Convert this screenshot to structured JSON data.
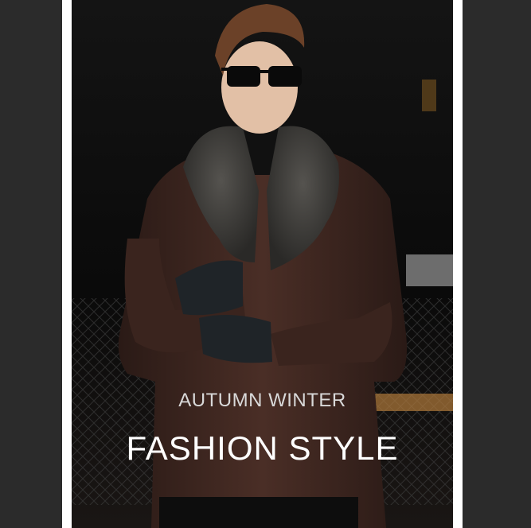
{
  "banner": {
    "subtitle": "AUTUMN WINTER",
    "title": "FASHION STYLE"
  },
  "colors": {
    "outer_background": "#2b2b2b",
    "border": "#ffffff",
    "photo_background": "#0d0d0d",
    "jacket": "#3a2520",
    "fur": "#3d3d3b",
    "text": "#ffffff"
  },
  "photo": {
    "subject": "model-in-leather-fur-collar-jacket"
  }
}
